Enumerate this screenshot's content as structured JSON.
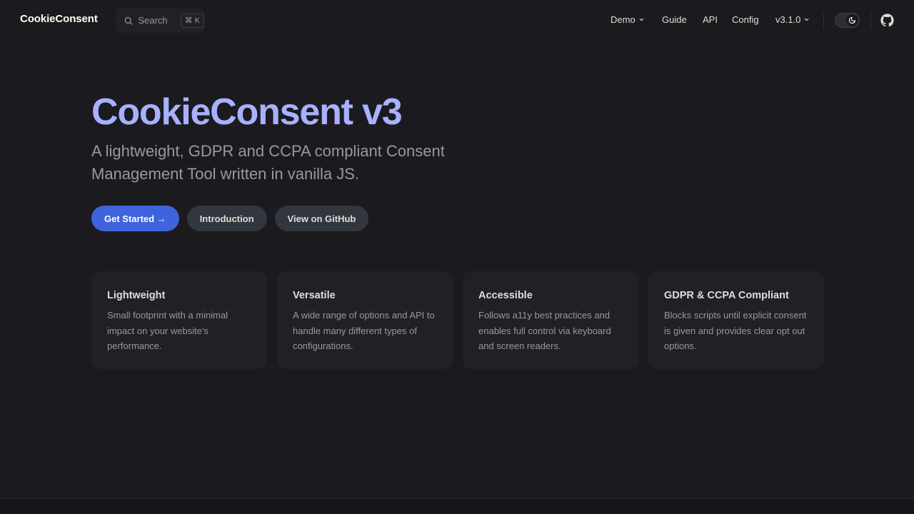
{
  "nav": {
    "brand": "CookieConsent",
    "search_label": "Search",
    "search_kbd_cmd": "⌘",
    "search_kbd_key": "K",
    "items": [
      {
        "label": "Demo",
        "has_dropdown": true
      },
      {
        "label": "Guide",
        "has_dropdown": false
      },
      {
        "label": "API",
        "has_dropdown": false
      },
      {
        "label": "Config",
        "has_dropdown": false
      },
      {
        "label": "v3.1.0",
        "has_dropdown": true
      }
    ],
    "theme_toggle_icon": "moon-icon",
    "github_icon": "github-icon"
  },
  "hero": {
    "title": "CookieConsent v3",
    "tagline": "A lightweight, GDPR and CCPA compliant Consent Management Tool written in vanilla JS.",
    "actions": [
      {
        "label": "Get Started →",
        "style": "brand"
      },
      {
        "label": "Introduction",
        "style": "alt"
      },
      {
        "label": "View on GitHub",
        "style": "alt"
      }
    ]
  },
  "features": [
    {
      "title": "Lightweight",
      "details": "Small footprint with a minimal impact on your website's performance."
    },
    {
      "title": "Versatile",
      "details": "A wide range of options and API to handle many different types of configurations."
    },
    {
      "title": "Accessible",
      "details": "Follows a11y best practices and enables full control via keyboard and screen readers."
    },
    {
      "title": "GDPR & CCPA Compliant",
      "details": "Blocks scripts until explicit consent is given and provides clear opt out options."
    }
  ],
  "colors": {
    "background": "#1b1b1f",
    "title": "#a8b1ff",
    "brand_button": "#3e63dd",
    "alt_button": "#32363f",
    "card": "#202127",
    "muted_text": "#98989f"
  }
}
